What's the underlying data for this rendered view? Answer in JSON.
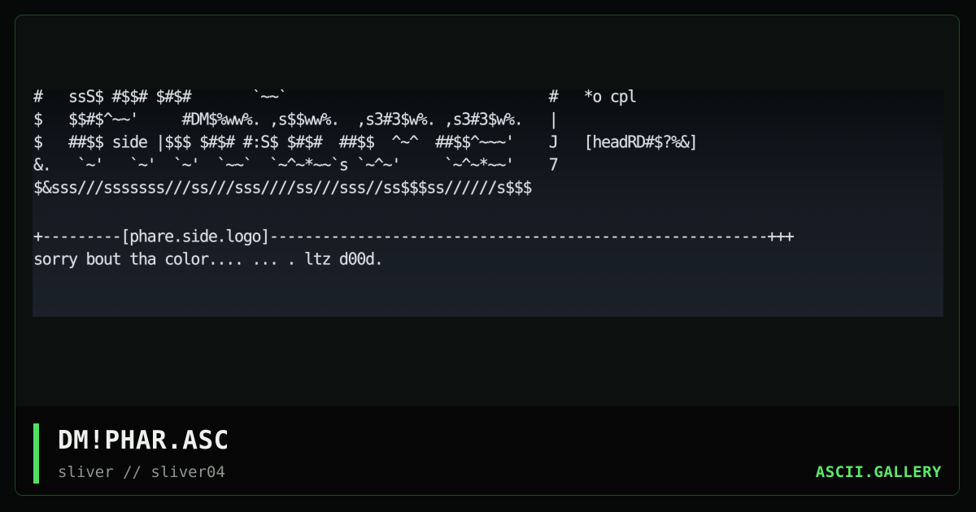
{
  "art": {
    "lines": [
      "#   ssS$ #$$# $#$#       `~~`                              #   *o cpl",
      "$   $$#$^~~'     #DM$%ww%. ,s$$ww%.  ,s3#3$w%. ,s3#3$w%.   |",
      "$   ##$$ side |$$$ $#$# #:S$ $#$#  ##$$  ^~^  ##$$^~~~'    J   [headRD#$?%&]",
      "&.   `~'   `~'  `~'  `~~`  `~^~*~~`s `~^~'     `~^~*~~'    7",
      "$&sss///sssssss///ss///sss////ss///sss//ss$$$ss//////s$$$"
    ],
    "footer_lines": [
      "+---------[phare.side.logo]---------------------------------------------------------+++",
      "sorry bout tha color.... ... . ltz d00d."
    ]
  },
  "file": {
    "title": "DM!PHAR.ASC",
    "subtitle": "sliver // sliver04"
  },
  "brand": {
    "label": "ASCII.GALLERY"
  },
  "colors": {
    "accent": "#4ee25e",
    "brand": "#5ee86c",
    "card_border": "#1c4a22",
    "art_text": "#d8dde2"
  }
}
